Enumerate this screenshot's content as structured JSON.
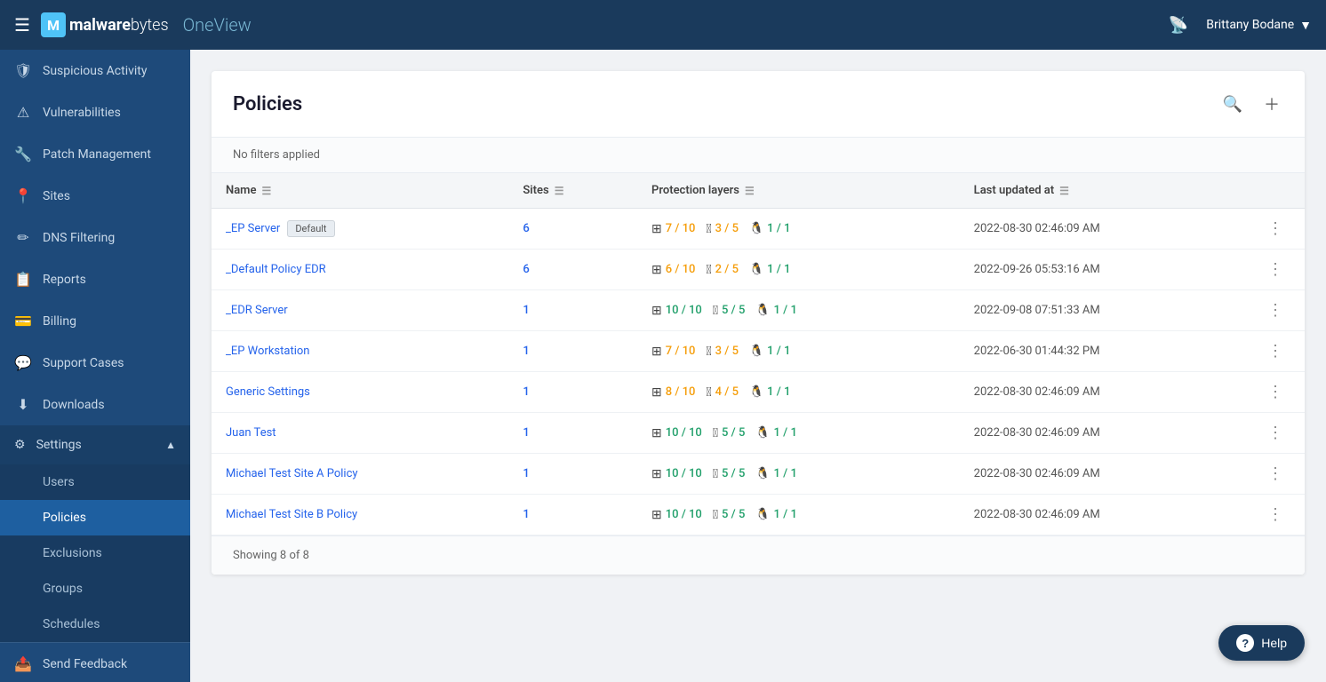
{
  "topnav": {
    "logo_bold": "malware",
    "logo_light": "bytes",
    "app_name": "OneView",
    "user_name": "Brittany Bodane"
  },
  "sidebar": {
    "items": [
      {
        "id": "suspicious-activity",
        "label": "Suspicious Activity",
        "icon": "🛡"
      },
      {
        "id": "vulnerabilities",
        "label": "Vulnerabilities",
        "icon": "⚠"
      },
      {
        "id": "patch-management",
        "label": "Patch Management",
        "icon": "🔧"
      },
      {
        "id": "sites",
        "label": "Sites",
        "icon": "📍"
      },
      {
        "id": "dns-filtering",
        "label": "DNS Filtering",
        "icon": "✏"
      },
      {
        "id": "reports",
        "label": "Reports",
        "icon": "📋"
      },
      {
        "id": "billing",
        "label": "Billing",
        "icon": "💳"
      },
      {
        "id": "support-cases",
        "label": "Support Cases",
        "icon": "💬"
      },
      {
        "id": "downloads",
        "label": "Downloads",
        "icon": "⬇"
      }
    ],
    "settings": {
      "label": "Settings",
      "icon": "⚙",
      "sub_items": [
        {
          "id": "users",
          "label": "Users"
        },
        {
          "id": "policies",
          "label": "Policies"
        },
        {
          "id": "exclusions",
          "label": "Exclusions"
        },
        {
          "id": "groups",
          "label": "Groups"
        },
        {
          "id": "schedules",
          "label": "Schedules"
        }
      ]
    },
    "send_feedback": {
      "label": "Send Feedback",
      "icon": "📤"
    }
  },
  "content": {
    "title": "Policies",
    "filter_text": "No filters applied",
    "showing_text": "Showing 8 of 8",
    "columns": {
      "name": "Name",
      "sites": "Sites",
      "protection_layers": "Protection layers",
      "last_updated": "Last updated at"
    },
    "policies": [
      {
        "name": "_EP Server",
        "is_default": true,
        "default_label": "Default",
        "sites": "6",
        "win_score": "7 / 10",
        "win_color": "yellow",
        "apple_score": "3 / 5",
        "apple_color": "yellow",
        "linux_score": "1 / 1",
        "linux_color": "green",
        "last_updated": "2022-08-30 02:46:09 AM"
      },
      {
        "name": "_Default Policy EDR",
        "is_default": false,
        "default_label": "",
        "sites": "6",
        "win_score": "6 / 10",
        "win_color": "yellow",
        "apple_score": "2 / 5",
        "apple_color": "yellow",
        "linux_score": "1 / 1",
        "linux_color": "green",
        "last_updated": "2022-09-26 05:53:16 AM"
      },
      {
        "name": "_EDR Server",
        "is_default": false,
        "default_label": "",
        "sites": "1",
        "win_score": "10 / 10",
        "win_color": "green",
        "apple_score": "5 / 5",
        "apple_color": "green",
        "linux_score": "1 / 1",
        "linux_color": "green",
        "last_updated": "2022-09-08 07:51:33 AM"
      },
      {
        "name": "_EP Workstation",
        "is_default": false,
        "default_label": "",
        "sites": "1",
        "win_score": "7 / 10",
        "win_color": "yellow",
        "apple_score": "3 / 5",
        "apple_color": "yellow",
        "linux_score": "1 / 1",
        "linux_color": "green",
        "last_updated": "2022-06-30 01:44:32 PM"
      },
      {
        "name": "Generic Settings",
        "is_default": false,
        "default_label": "",
        "sites": "1",
        "win_score": "8 / 10",
        "win_color": "yellow",
        "apple_score": "4 / 5",
        "apple_color": "yellow",
        "linux_score": "1 / 1",
        "linux_color": "green",
        "last_updated": "2022-08-30 02:46:09 AM"
      },
      {
        "name": "Juan Test",
        "is_default": false,
        "default_label": "",
        "sites": "1",
        "win_score": "10 / 10",
        "win_color": "green",
        "apple_score": "5 / 5",
        "apple_color": "green",
        "linux_score": "1 / 1",
        "linux_color": "green",
        "last_updated": "2022-08-30 02:46:09 AM"
      },
      {
        "name": "Michael Test Site A Policy",
        "is_default": false,
        "default_label": "",
        "sites": "1",
        "win_score": "10 / 10",
        "win_color": "green",
        "apple_score": "5 / 5",
        "apple_color": "green",
        "linux_score": "1 / 1",
        "linux_color": "green",
        "last_updated": "2022-08-30 02:46:09 AM"
      },
      {
        "name": "Michael Test Site B Policy",
        "is_default": false,
        "default_label": "",
        "sites": "1",
        "win_score": "10 / 10",
        "win_color": "green",
        "apple_score": "5 / 5",
        "apple_color": "green",
        "linux_score": "1 / 1",
        "linux_color": "green",
        "last_updated": "2022-08-30 02:46:09 AM"
      }
    ]
  },
  "help_button": {
    "label": "Help"
  }
}
